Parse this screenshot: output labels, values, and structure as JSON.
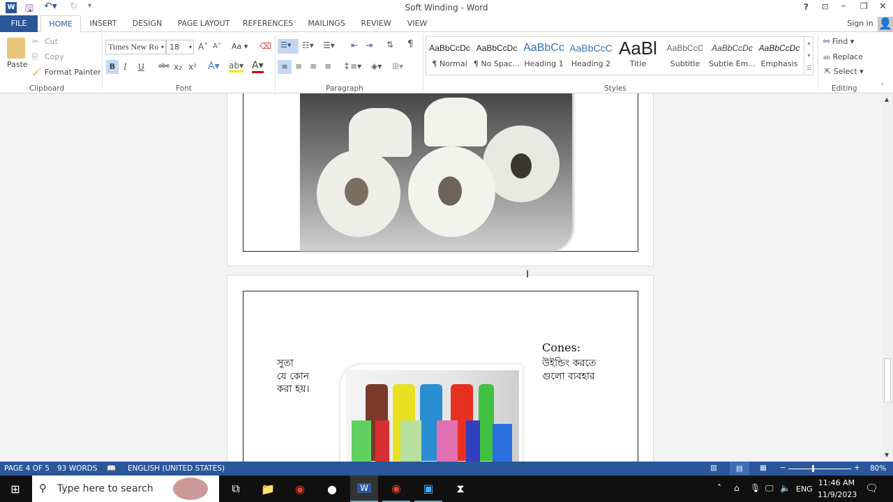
{
  "window": {
    "title": "Soft Winding - Word",
    "help": "?",
    "sign_in": "Sign in"
  },
  "tabs": [
    "FILE",
    "HOME",
    "INSERT",
    "DESIGN",
    "PAGE LAYOUT",
    "REFERENCES",
    "MAILINGS",
    "REVIEW",
    "VIEW"
  ],
  "clipboard": {
    "paste": "Paste",
    "cut": "Cut",
    "copy": "Copy",
    "format_painter": "Format Painter",
    "label": "Clipboard"
  },
  "font": {
    "name": "Times New Ro",
    "size": "18",
    "label": "Font",
    "bold": "B",
    "italic": "I",
    "underline": "U",
    "strike": "abc",
    "sub": "x₂",
    "sup": "x²",
    "case": "Aa"
  },
  "paragraph": {
    "label": "Paragraph"
  },
  "styles": {
    "label": "Styles",
    "items": [
      {
        "preview": "AaBbCcDc",
        "name": "¶ Normal"
      },
      {
        "preview": "AaBbCcDc",
        "name": "¶ No Spac..."
      },
      {
        "preview": "AaBbCc",
        "name": "Heading 1"
      },
      {
        "preview": "AaBbCcC",
        "name": "Heading 2"
      },
      {
        "preview": "AaBl",
        "name": "Title"
      },
      {
        "preview": "AaBbCcC",
        "name": "Subtitle"
      },
      {
        "preview": "AaBbCcDc",
        "name": "Subtle Em..."
      },
      {
        "preview": "AaBbCcDc",
        "name": "Emphasis"
      }
    ]
  },
  "editing": {
    "label": "Editing",
    "find": "Find",
    "replace": "Replace",
    "select": "Select"
  },
  "document": {
    "left_lines": [
      "সুতা",
      "যে কোন",
      "করা হয়।"
    ],
    "right_title": "Cones:",
    "right_lines": [
      "উইন্ডিং করতে",
      "গুলো ব্যবহার"
    ]
  },
  "status": {
    "page": "PAGE 4 OF 5",
    "words": "93 WORDS",
    "language": "ENGLISH (UNITED STATES)",
    "zoom": "80%",
    "zoom_percent": 80
  },
  "taskbar": {
    "search_placeholder": "Type here to search",
    "time": "11:46 AM",
    "date": "11/9/2023",
    "lang": "ENG"
  }
}
